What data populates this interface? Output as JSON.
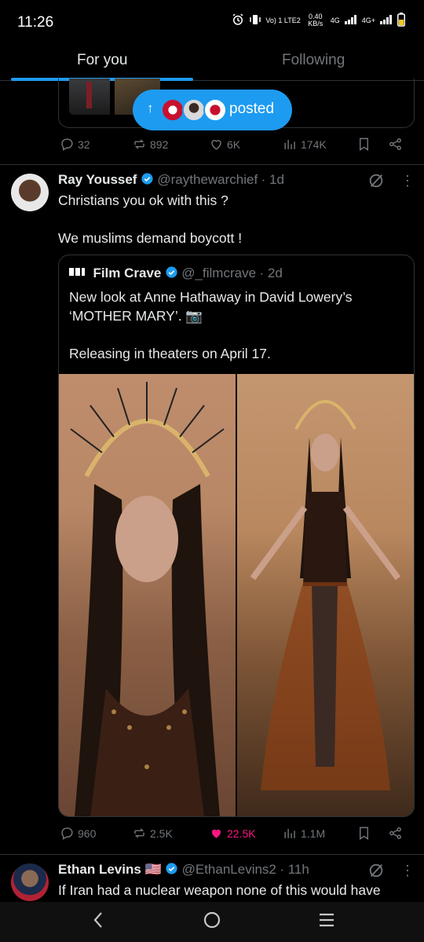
{
  "status_bar": {
    "time": "11:26",
    "network_line1": "Vo) 1 LTE2",
    "speed": "0.40 KB/s",
    "net_4g_1": "4G",
    "net_4g_2": "4G+"
  },
  "tabs": [
    {
      "label": "For you",
      "active": true
    },
    {
      "label": "Following",
      "active": false
    }
  ],
  "posted_pill": {
    "label": "posted"
  },
  "prev_tweet_actions": {
    "replies": "32",
    "reposts": "892",
    "likes": "6K",
    "views": "174K"
  },
  "tweet": {
    "author_name": "Ray Youssef",
    "author_handle": "@raythewarchief",
    "time": "· 1d",
    "text": "Christians you ok with this ?\n\nWe muslims demand boycott !",
    "quote": {
      "author_name": "Film Crave",
      "author_handle": "@_filmcrave",
      "time": "· 2d",
      "text": "New look at Anne Hathaway in David Lowery’s ‘MOTHER MARY’. 📷\n\nReleasing in theaters on April 17."
    },
    "actions": {
      "replies": "960",
      "reposts": "2.5K",
      "likes": "22.5K",
      "views": "1.1M"
    }
  },
  "next_tweet": {
    "author_name": "Ethan Levins 🇺🇸",
    "author_handle": "@EthanLevins2",
    "time": "· 11h",
    "text": "If Iran had a nuclear weapon none of this would have"
  },
  "colors": {
    "accent": "#1d9bf0",
    "like_active": "#f91880",
    "muted": "#71767b"
  }
}
